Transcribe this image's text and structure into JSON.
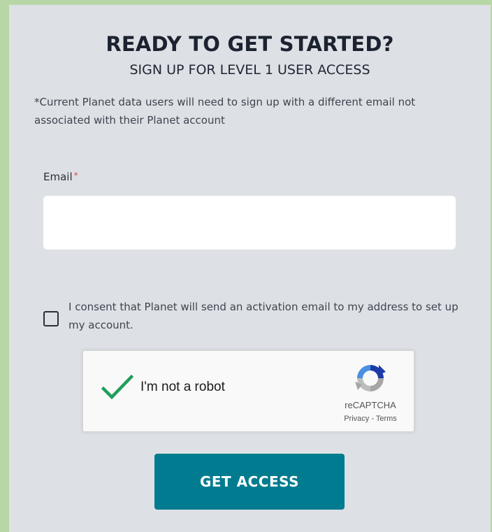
{
  "form": {
    "headline": "READY TO GET STARTED?",
    "subheadline": "SIGN UP FOR LEVEL 1 USER ACCESS",
    "note": "*Current Planet data users will need to sign up with a different email not associated with their Planet account",
    "email": {
      "label": "Email",
      "required_marker": "*",
      "value": "",
      "placeholder": ""
    },
    "consent": {
      "checked": false,
      "text": "I consent that Planet will send an activation email to my address to set up my account."
    },
    "recaptcha": {
      "label": "I'm not a robot",
      "checked": true,
      "brand": "reCAPTCHA",
      "privacy": "Privacy",
      "separator": " - ",
      "terms": "Terms",
      "check_icon": "checkmark-icon",
      "logo_icon": "recaptcha-logo-icon"
    },
    "submit_label": "GET ACCESS"
  },
  "colors": {
    "background_frame": "#b8d7a6",
    "panel": "#dde1e5",
    "accent_button": "#007b8f",
    "required": "#e24a4a",
    "check": "#1e9e5a"
  }
}
